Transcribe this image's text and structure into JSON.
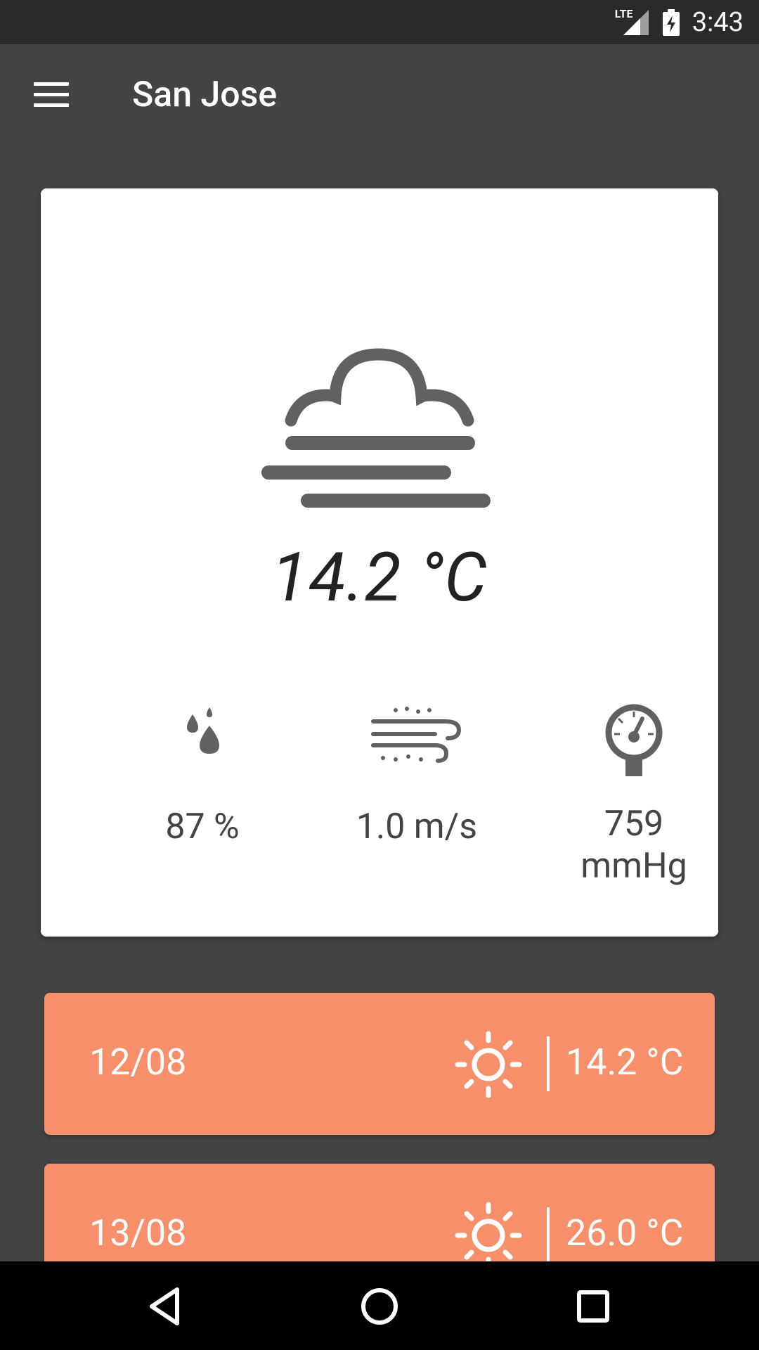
{
  "status_bar": {
    "time": "3:43",
    "network": "LTE",
    "icons": [
      "signal-icon",
      "battery-charging-icon"
    ]
  },
  "app_bar": {
    "title": "San Jose",
    "menu_icon": "hamburger-menu-icon"
  },
  "current": {
    "condition_icon": "fog-icon",
    "temperature": "14.2 °C",
    "humidity": "87 %",
    "wind": "1.0 m/s",
    "pressure_value": "759",
    "pressure_unit": "mmHg"
  },
  "forecast": [
    {
      "date": "12/08",
      "icon": "sun-icon",
      "temperature": "14.2 °C"
    },
    {
      "date": "13/08",
      "icon": "sun-icon",
      "temperature": "26.0 °C"
    }
  ],
  "colors": {
    "background": "#444444",
    "card": "#ffffff",
    "forecast_card": "#f78f6a",
    "icon_gray": "#616161"
  },
  "nav_bar": {
    "icons": [
      "back-icon",
      "home-icon",
      "recents-icon"
    ]
  }
}
